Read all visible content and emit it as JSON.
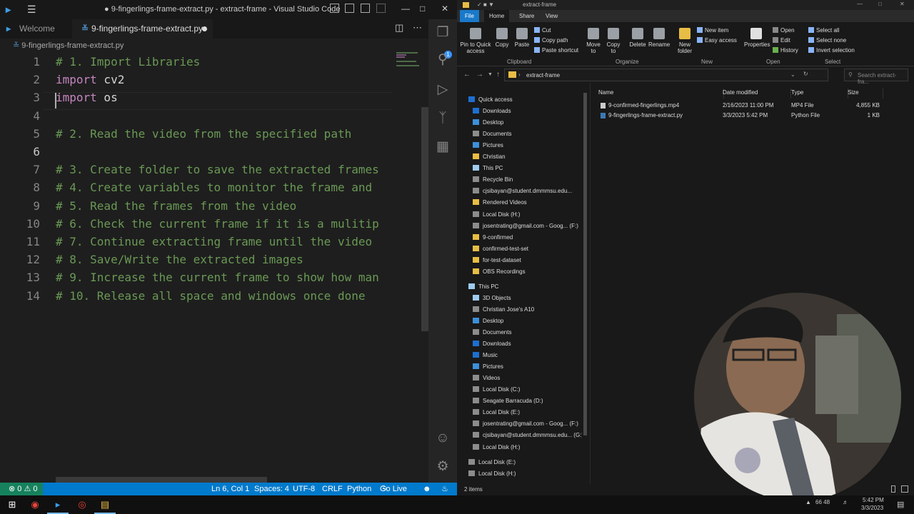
{
  "vscode": {
    "title": "● 9-fingerlings-frame-extract.py - extract-frame - Visual Studio Code",
    "tabs": [
      {
        "label": "Welcome"
      },
      {
        "label": "9-fingerlings-frame-extract.py"
      }
    ],
    "breadcrumb": "9-fingerlings-frame-extract.py",
    "code_lines": [
      {
        "n": "1",
        "tokens": [
          {
            "t": "# 1. Import Libraries",
            "c": "cm"
          }
        ]
      },
      {
        "n": "2",
        "tokens": [
          {
            "t": "import",
            "c": "kw"
          },
          {
            "t": " cv2",
            "c": ""
          }
        ]
      },
      {
        "n": "3",
        "tokens": [
          {
            "t": "import",
            "c": "kw"
          },
          {
            "t": " os",
            "c": ""
          }
        ]
      },
      {
        "n": "4",
        "tokens": []
      },
      {
        "n": "5",
        "tokens": [
          {
            "t": "# 2. Read the video from the specified path",
            "c": "cm"
          }
        ]
      },
      {
        "n": "6",
        "tokens": []
      },
      {
        "n": "7",
        "tokens": [
          {
            "t": "# 3. Create folder to save the extracted frames",
            "c": "cm"
          }
        ]
      },
      {
        "n": "8",
        "tokens": [
          {
            "t": "# 4. Create variables to monitor the frame and",
            "c": "cm"
          }
        ]
      },
      {
        "n": "9",
        "tokens": [
          {
            "t": "# 5. Read the frames from the video",
            "c": "cm"
          }
        ]
      },
      {
        "n": "10",
        "tokens": [
          {
            "t": "# 6. Check the current frame if it is a mulitip",
            "c": "cm"
          }
        ]
      },
      {
        "n": "11",
        "tokens": [
          {
            "t": "# 7. Continue extracting frame until the video",
            "c": "cm"
          }
        ]
      },
      {
        "n": "12",
        "tokens": [
          {
            "t": "# 8. Save/Write the extracted images",
            "c": "cm"
          }
        ]
      },
      {
        "n": "13",
        "tokens": [
          {
            "t": "# 9. Increase the current frame to show how man",
            "c": "cm"
          }
        ]
      },
      {
        "n": "14",
        "tokens": [
          {
            "t": "# 10. Release all space and windows once done",
            "c": "cm"
          }
        ]
      }
    ],
    "status": {
      "problems": "⊗ 0 ⚠ 0",
      "position": "Ln 6, Col 1",
      "spaces": "Spaces: 4",
      "encoding": "UTF-8",
      "eol": "CRLF",
      "language": "Python",
      "golive": "Go Live"
    }
  },
  "explorer": {
    "title": "extract-frame",
    "ribbon_tabs": [
      "File",
      "Home",
      "Share",
      "View"
    ],
    "buttons": {
      "pin": "Pin to Quick access",
      "copy": "Copy",
      "paste": "Paste",
      "cut": "Cut",
      "copy_path": "Copy path",
      "paste_shortcut": "Paste shortcut",
      "move_to": "Move to",
      "copy_to": "Copy to",
      "delete": "Delete",
      "rename": "Rename",
      "new_folder": "New folder",
      "new_item": "New item",
      "easy_access": "Easy access",
      "properties": "Properties",
      "open": "Open",
      "edit": "Edit",
      "history": "History",
      "select_all": "Select all",
      "select_none": "Select none",
      "invert_selection": "Invert selection"
    },
    "groups": [
      "Clipboard",
      "Organize",
      "New",
      "Open",
      "Select"
    ],
    "path": "extract-frame",
    "search_placeholder": "Search extract-fra...",
    "nav": [
      {
        "label": "Quick access",
        "icon": "star",
        "pinned": false
      },
      {
        "label": "Downloads",
        "icon": "download",
        "pinned": true
      },
      {
        "label": "Desktop",
        "icon": "desktop",
        "pinned": true
      },
      {
        "label": "Documents",
        "icon": "docs",
        "pinned": true
      },
      {
        "label": "Pictures",
        "icon": "pictures",
        "pinned": true
      },
      {
        "label": "Christian",
        "icon": "folder",
        "pinned": true
      },
      {
        "label": "This PC",
        "icon": "pc",
        "pinned": true
      },
      {
        "label": "Recycle Bin",
        "icon": "bin",
        "pinned": true
      },
      {
        "label": "cjsibayan@student.dmmmsu.edu...",
        "icon": "drive",
        "pinned": true
      },
      {
        "label": "Rendered Videos",
        "icon": "folder",
        "pinned": true
      },
      {
        "label": "Local Disk (H:)",
        "icon": "drive",
        "pinned": true
      },
      {
        "label": "josentrating@gmail.com - Goog... (F:)",
        "icon": "drive",
        "pinned": true
      },
      {
        "label": "9-confirmed",
        "icon": "folder",
        "pinned": false
      },
      {
        "label": "confirmed-test-set",
        "icon": "folder",
        "pinned": false
      },
      {
        "label": "for-test-dataset",
        "icon": "folder",
        "pinned": false
      },
      {
        "label": "OBS Recordings",
        "icon": "folder",
        "pinned": false
      },
      {
        "label": "This PC",
        "icon": "pc",
        "pinned": false
      },
      {
        "label": "3D Objects",
        "icon": "3d",
        "pinned": false
      },
      {
        "label": "Christian Jose's A10",
        "icon": "phone",
        "pinned": false
      },
      {
        "label": "Desktop",
        "icon": "desktop",
        "pinned": false
      },
      {
        "label": "Documents",
        "icon": "docs",
        "pinned": false
      },
      {
        "label": "Downloads",
        "icon": "download",
        "pinned": false
      },
      {
        "label": "Music",
        "icon": "music",
        "pinned": false
      },
      {
        "label": "Pictures",
        "icon": "pictures",
        "pinned": false
      },
      {
        "label": "Videos",
        "icon": "videos",
        "pinned": false
      },
      {
        "label": "Local Disk (C:)",
        "icon": "drive",
        "pinned": false
      },
      {
        "label": "Seagate Barracuda (D:)",
        "icon": "drive",
        "pinned": false
      },
      {
        "label": "Local Disk (E:)",
        "icon": "drive",
        "pinned": false
      },
      {
        "label": "josentrating@gmail.com - Goog... (F:)",
        "icon": "drive",
        "pinned": false
      },
      {
        "label": "cjsibayan@student.dmmmsu.edu... (G:)",
        "icon": "drive",
        "pinned": false
      },
      {
        "label": "Local Disk (H:)",
        "icon": "drive",
        "pinned": false
      },
      {
        "label": "Local Disk (E:)",
        "icon": "drive",
        "pinned": false
      },
      {
        "label": "Local Disk (H:)",
        "icon": "drive",
        "pinned": false
      }
    ],
    "columns": [
      "Name",
      "Date modified",
      "Type",
      "Size"
    ],
    "files": [
      {
        "name": "9-confirmed-fingerlings.mp4",
        "date": "2/16/2023 11:00 PM",
        "type": "MP4 File",
        "size": "4,855 KB"
      },
      {
        "name": "9-fingerlings-frame-extract.py",
        "date": "3/3/2023 5:42 PM",
        "type": "Python File",
        "size": "1 KB"
      }
    ],
    "item_count": "2 items"
  },
  "taskbar": {
    "time": "5:42 PM",
    "date": "3/3/2023",
    "tray": "66  48"
  },
  "colors": {
    "accent": "#007acc",
    "comment": "#6a9955",
    "keyword": "#c586c0"
  }
}
